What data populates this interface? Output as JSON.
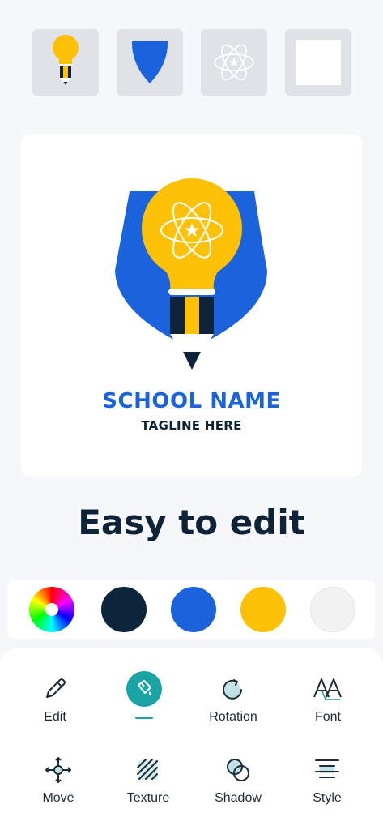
{
  "thumbnails": [
    {
      "name": "lightbulb-pencil-thumb",
      "icon": "lightbulb-pencil-icon"
    },
    {
      "name": "shield-thumb",
      "icon": "shield-icon"
    },
    {
      "name": "atom-thumb",
      "icon": "atom-icon"
    },
    {
      "name": "blank-thumb",
      "icon": "blank-square"
    }
  ],
  "logo": {
    "school_name": "SCHOOL NAME",
    "tagline": "TAGLINE HERE",
    "colors": {
      "shield": "#1b63dc",
      "bulb": "#ffc107",
      "pencil_dark": "#0e2238",
      "white": "#ffffff"
    }
  },
  "headline": "Easy to edit",
  "palette": {
    "swatches": [
      {
        "name": "color-wheel",
        "color": "conic"
      },
      {
        "name": "swatch-navy",
        "color": "#0c253a"
      },
      {
        "name": "swatch-blue",
        "color": "#1b63dc"
      },
      {
        "name": "swatch-yellow",
        "color": "#ffc107"
      },
      {
        "name": "swatch-white",
        "color": "#f2f2f2"
      }
    ]
  },
  "tools": {
    "edit": "Edit",
    "fill": "",
    "rotation": "Rotation",
    "font": "Font",
    "move": "Move",
    "texture": "Texture",
    "shadow": "Shadow",
    "style": "Style"
  },
  "accent_color": "#1aa4a4"
}
